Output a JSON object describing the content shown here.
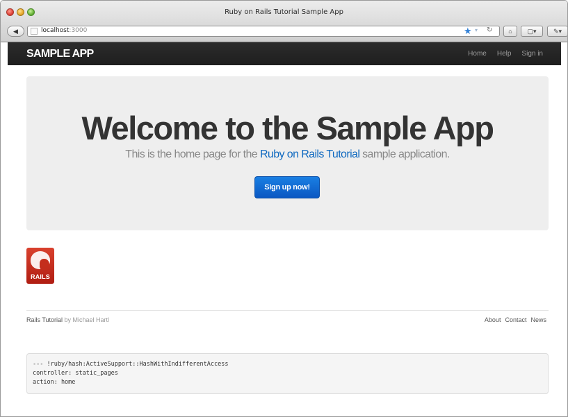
{
  "window": {
    "title": "Ruby on Rails Tutorial Sample App"
  },
  "toolbar": {
    "back_symbol": "◀",
    "url_host": "localhost",
    "url_port": ":3000",
    "home_symbol": "⌂",
    "tabs_symbol": "▢▾",
    "more_symbol": "✎▾"
  },
  "navbar": {
    "logo": "SAMPLE APP",
    "links": [
      "Home",
      "Help",
      "Sign in"
    ]
  },
  "hero": {
    "title": "Welcome to the Sample App",
    "subtitle_pre": "This is the home page for the ",
    "subtitle_link": "Ruby on Rails Tutorial",
    "subtitle_post": " sample application.",
    "button": "Sign up now!"
  },
  "rails_logo": {
    "word": "RAILS"
  },
  "footer": {
    "left_link": "Rails Tutorial",
    "by_text": " by Michael Hartl",
    "links": [
      "About",
      "Contact",
      "News"
    ]
  },
  "debug": {
    "lines": [
      "--- !ruby/hash:ActiveSupport::HashWithIndifferentAccess",
      "controller: static_pages",
      "action: home"
    ]
  },
  "colors": {
    "navbar": "#222222",
    "hero_bg": "#eeeeee",
    "link_blue": "#0f69c0",
    "button_blue": "#0a57c2"
  }
}
